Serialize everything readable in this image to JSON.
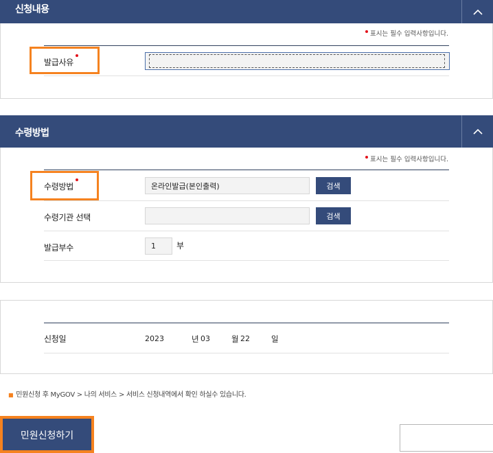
{
  "section1": {
    "title": "신청내용"
  },
  "section2": {
    "title": "수령방법"
  },
  "required_note": "표시는 필수 입력사항입니다.",
  "fields": {
    "issue_reason_label": "발급사유",
    "receive_method_label": "수령방법",
    "receive_method_value": "온라인발급(본인출력)",
    "receive_org_label": "수령기관 선택",
    "copies_label": "발급부수",
    "copies_value": "1",
    "copies_unit": "부",
    "search_label": "검색"
  },
  "apply_date": {
    "label": "신청일",
    "year": "2023",
    "year_unit": "년",
    "month": "03",
    "month_unit": "월",
    "day": "22",
    "day_unit": "일"
  },
  "footnote": "민원신청 후 MyGOV > 나의 서비스 > 서비스 신청내역에서 확인 하실수 있습니다.",
  "submit_label": "민원신청하기",
  "icons": {
    "collapse": "chevron-up-icon",
    "required": "red-dot"
  },
  "colors": {
    "header": "#344b7a",
    "highlight": "#f5821f",
    "required": "#e3131b"
  }
}
